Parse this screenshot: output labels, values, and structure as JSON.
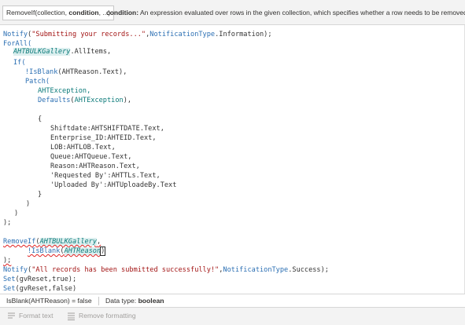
{
  "signature_bar": {
    "prefix": "RemoveIf(collection, ",
    "bold": "condition",
    "suffix": ", ...)",
    "desc_label": "condition:",
    "desc_text": " An expression evaluated over rows in the given collection, which specifies whether a row needs to be removed."
  },
  "code": {
    "l1_fn": "Notify",
    "l1_open": "(",
    "l1_str": "\"Submitting your records...\"",
    "l1_comma": ",",
    "l1_enum": "NotificationType",
    "l1_tail": ".Information);",
    "l2": "ForAll(",
    "l3_var": "AHTBULKGallery",
    "l3_tail": ".AllItems,",
    "l4": "If(",
    "l5_fn": "!IsBlank",
    "l5_tail": "(AHTReason.Text),",
    "l6": "Patch(",
    "l7": "AHTException,",
    "l8_fn": "Defaults",
    "l8_open": "(",
    "l8_var": "AHTException",
    "l8_tail": "),",
    "l9": "{",
    "l10": "Shiftdate:AHTSHIFTDATE.Text,",
    "l11": "Enterprise_ID:AHTEID.Text,",
    "l12": "LOB:AHTLOB.Text,",
    "l13": "Queue:AHTQueue.Text,",
    "l14": "Reason:AHTReason.Text,",
    "l15": "'Requested By':AHTTLs.Text,",
    "l16": "'Uploaded By':AHTUploadeBy.Text",
    "l17": "}",
    "l18": ")",
    "l19": ")",
    "l20": ");",
    "l21_fn": "RemoveIf",
    "l21_open": "(",
    "l21_var": "AHTBULKGallery",
    "l21_tail": ",",
    "l22_fn": "!IsBlank",
    "l22_open": "(",
    "l22_var": "AHTReason",
    "l22_close": ")",
    "l23": ");",
    "l24_fn": "Notify",
    "l24_open": "(",
    "l24_str": "\"All records has been submitted successfully!\"",
    "l24_comma": ",",
    "l24_enum": "NotificationType",
    "l24_tail": ".Success);",
    "l25_fn": "Set",
    "l25_tail": "(gvReset,true);",
    "l26_fn": "Set",
    "l26_tail": "(gvReset,false)"
  },
  "result_bar": {
    "expression": "IsBlank(AHTReason)  =  false",
    "data_type_label": "Data type: ",
    "data_type_value": "boolean"
  },
  "bottom_bar": {
    "format_text": "Format text",
    "remove_formatting": "Remove formatting"
  }
}
